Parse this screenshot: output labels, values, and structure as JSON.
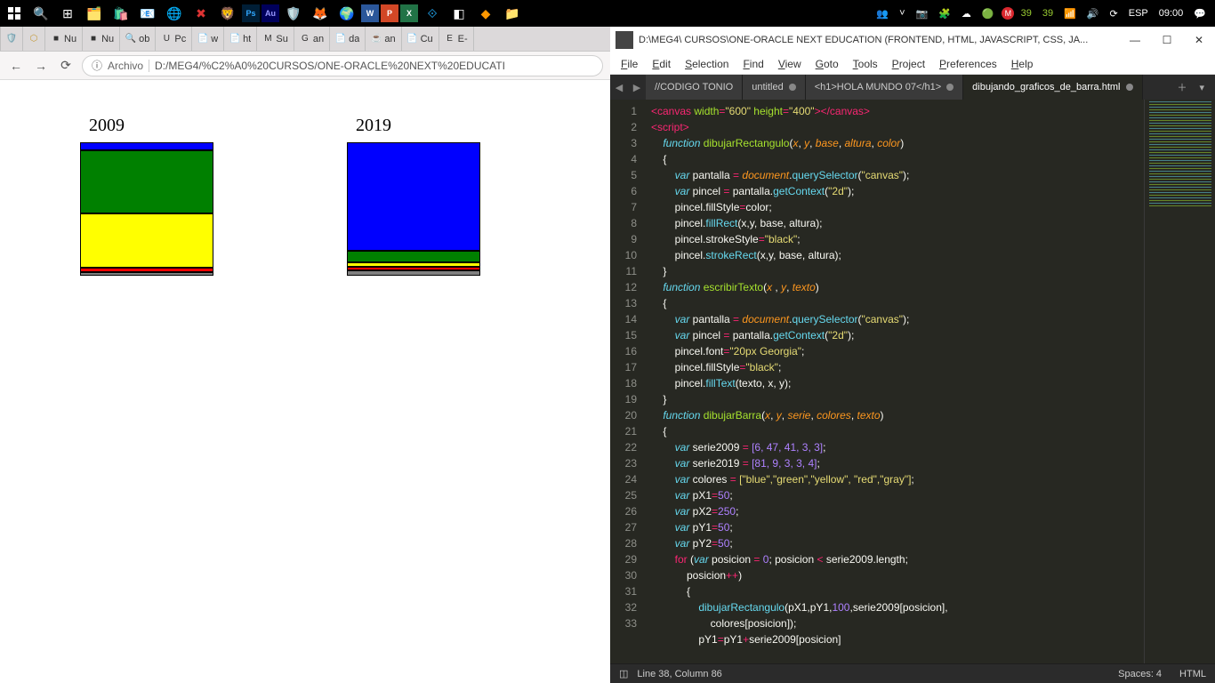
{
  "taskbar": {
    "right": {
      "badge1": "39",
      "badge2": "39",
      "lang": "ESP",
      "time": "09:00"
    }
  },
  "browser": {
    "tabs": [
      {
        "fav": "■",
        "label": "Nu"
      },
      {
        "fav": "■",
        "label": "Nu"
      },
      {
        "fav": "🔍",
        "label": "ob"
      },
      {
        "fav": "U",
        "label": "Pc"
      },
      {
        "fav": "📄",
        "label": "w"
      },
      {
        "fav": "📄",
        "label": "ht"
      },
      {
        "fav": "M",
        "label": "Su"
      },
      {
        "fav": "G",
        "label": "an"
      },
      {
        "fav": "📄",
        "label": "da"
      },
      {
        "fav": "☕",
        "label": "an"
      },
      {
        "fav": "📄",
        "label": "Cu"
      },
      {
        "fav": "E",
        "label": "E-"
      }
    ],
    "back": "←",
    "forward": "→",
    "reload": "⟳",
    "protocol": "Archivo",
    "url": "D:/MEG4/%C2%A0%20CURSOS/ONE-ORACLE%20NEXT%20EDUCATI"
  },
  "chart_data": [
    {
      "type": "bar",
      "title": "2009",
      "categories": [
        "blue",
        "green",
        "yellow",
        "red",
        "gray"
      ],
      "values": [
        6,
        47,
        41,
        3,
        3
      ],
      "colors": [
        "blue",
        "green",
        "yellow",
        "red",
        "gray"
      ],
      "xlabel": "",
      "ylabel": "",
      "ylim": [
        0,
        100
      ]
    },
    {
      "type": "bar",
      "title": "2019",
      "categories": [
        "blue",
        "green",
        "yellow",
        "red",
        "gray"
      ],
      "values": [
        81,
        9,
        3,
        3,
        4
      ],
      "colors": [
        "blue",
        "green",
        "yellow",
        "red",
        "gray"
      ],
      "xlabel": "",
      "ylabel": "",
      "ylim": [
        0,
        100
      ]
    }
  ],
  "editor": {
    "title": "D:\\MEG4\\  CURSOS\\ONE-ORACLE NEXT EDUCATION (FRONTEND, HTML, JAVASCRIPT, CSS, JA...",
    "menu": [
      "File",
      "Edit",
      "Selection",
      "Find",
      "View",
      "Goto",
      "Tools",
      "Project",
      "Preferences",
      "Help"
    ],
    "tabs": [
      {
        "label": "//CODIGO TONIO",
        "dirty": false,
        "active": false
      },
      {
        "label": "untitled",
        "dirty": true,
        "active": false
      },
      {
        "label": "<h1>HOLA MUNDO 07</h1>",
        "dirty": true,
        "active": false
      },
      {
        "label": "dibujando_graficos_de_barra.html",
        "dirty": true,
        "active": true
      }
    ],
    "status": {
      "position": "Line 38, Column 86",
      "spaces": "Spaces: 4",
      "lang": "HTML"
    },
    "code": {
      "canvas_width": "600",
      "canvas_height": "400",
      "fn1": "dibujarRectangulo",
      "fn1p": "x, y, base, altura, color",
      "fn2": "escribirTexto",
      "fn2p": "x , y, texto",
      "fn3": "dibujarBarra",
      "fn3p": "x, y, serie, colores, texto",
      "serie2009": "[6, 47, 41, 3, 3]",
      "serie2019": "[81, 9, 3, 3, 4]",
      "colores": "[\"blue\",\"green\",\"yellow\", \"red\",\"gray\"]",
      "pX1": "50",
      "pX2": "250",
      "pY1": "50",
      "pY2": "50",
      "font": "\"20px Georgia\"",
      "fillStyleBlack": "\"black\"",
      "qs": "\"canvas\"",
      "ctx2d": "\"2d\""
    }
  }
}
